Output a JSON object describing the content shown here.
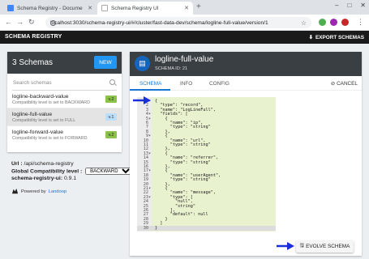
{
  "browser": {
    "tabs": [
      {
        "title": "Schema Registry - Docume",
        "favicon_color": "#4285f4",
        "active": false
      },
      {
        "title": "Schema Registry UI",
        "favicon_color": "#ffffff",
        "active": true
      }
    ],
    "new_tab_glyph": "+",
    "window_controls": [
      "–",
      "□",
      "✕"
    ],
    "nav": {
      "back": "←",
      "forward": "→",
      "reload": "↻"
    },
    "url": "localhost:3030/schema-registry-ui/#/cluster/fast-data-dev/schema/logline-full-value/version/1",
    "star": "☆"
  },
  "app": {
    "brand": "SCHEMA REGISTRY",
    "export_label": "EXPORT SCHEMAS"
  },
  "sidebar": {
    "count_label": "3 Schemas",
    "new_button": "NEW",
    "search_placeholder": "Search schemas",
    "items": [
      {
        "name": "logline-backward-value",
        "desc": "Compatibility level is set to BACKWARD",
        "version": "v.2",
        "selected": false
      },
      {
        "name": "logline-full-value",
        "desc": "Compatibility level is set to FULL",
        "version": "v.1",
        "selected": true
      },
      {
        "name": "logline-forward-value",
        "desc": "Compatibility level is set to FORWARD",
        "version": "v.2",
        "selected": false
      }
    ]
  },
  "info": {
    "url_label": "Url :",
    "url_value": "/api/schema-registry",
    "compat_label": "Global Compatibility level :",
    "compat_value": "BACKWARD",
    "version_label": "schema-registry-ui:",
    "version_value": "0.9.1",
    "powered_by": "Powered by",
    "powered_link": "Landoop"
  },
  "detail": {
    "title": "logline-full-value",
    "schema_id": "SCHEMA ID: 21",
    "tabs": [
      "SCHEMA",
      "INFO",
      "CONFIG"
    ],
    "active_tab": "SCHEMA",
    "cancel_label": "CANCEL",
    "evolve_label": "EVOLVE SCHEMA"
  },
  "editor": {
    "lines": [
      {
        "n": "1",
        "fold": "▾",
        "code": "{"
      },
      {
        "n": "2",
        "fold": "",
        "code": "  \"type\": \"record\","
      },
      {
        "n": "3",
        "fold": "",
        "code": "  \"name\": \"LogLineFull\","
      },
      {
        "n": "4",
        "fold": "▾",
        "code": "  \"fields\": ["
      },
      {
        "n": "5",
        "fold": "▾",
        "code": "    {"
      },
      {
        "n": "6",
        "fold": "",
        "code": "      \"name\": \"ip\","
      },
      {
        "n": "7",
        "fold": "",
        "code": "      \"type\": \"string\""
      },
      {
        "n": "8",
        "fold": "",
        "code": "    },"
      },
      {
        "n": "9",
        "fold": "▾",
        "code": "    {"
      },
      {
        "n": "10",
        "fold": "",
        "code": "      \"name\": \"url\","
      },
      {
        "n": "11",
        "fold": "",
        "code": "      \"type\": \"string\""
      },
      {
        "n": "12",
        "fold": "",
        "code": "    },"
      },
      {
        "n": "13",
        "fold": "▾",
        "code": "    {"
      },
      {
        "n": "14",
        "fold": "",
        "code": "      \"name\": \"referrer\","
      },
      {
        "n": "15",
        "fold": "",
        "code": "      \"type\": \"string\""
      },
      {
        "n": "16",
        "fold": "",
        "code": "    },"
      },
      {
        "n": "17",
        "fold": "▾",
        "code": "    {"
      },
      {
        "n": "18",
        "fold": "",
        "code": "      \"name\": \"userAgent\","
      },
      {
        "n": "19",
        "fold": "",
        "code": "      \"type\": \"string\""
      },
      {
        "n": "20",
        "fold": "",
        "code": "    },"
      },
      {
        "n": "21",
        "fold": "▾",
        "code": "    {"
      },
      {
        "n": "22",
        "fold": "",
        "code": "      \"name\": \"message\","
      },
      {
        "n": "23",
        "fold": "▾",
        "code": "      \"type\": ["
      },
      {
        "n": "24",
        "fold": "",
        "code": "        \"null\","
      },
      {
        "n": "25",
        "fold": "",
        "code": "        \"string\""
      },
      {
        "n": "26",
        "fold": "",
        "code": "      ],"
      },
      {
        "n": "27",
        "fold": "",
        "code": "      \"default\": null"
      },
      {
        "n": "28",
        "fold": "",
        "code": "    }"
      },
      {
        "n": "29",
        "fold": "",
        "code": "  ]"
      },
      {
        "n": "30",
        "fold": "",
        "code": "}"
      }
    ]
  },
  "colors": {
    "accent": "#1976d2",
    "new_button": "#2196f3",
    "header_dark": "#3a3f44",
    "editor_bg": "#e9f2cf",
    "annotation_arrow": "#1a2fd6"
  }
}
